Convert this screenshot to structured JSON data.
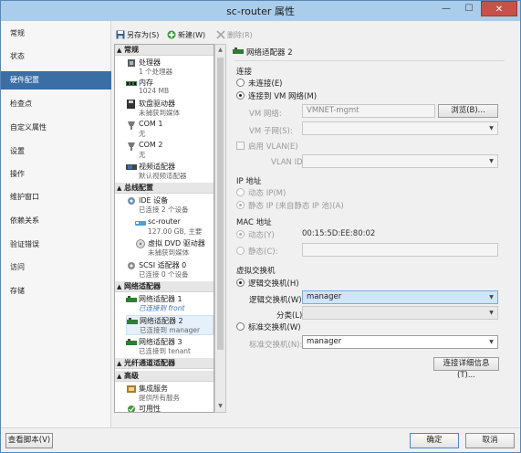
{
  "window": {
    "title": "sc-router 属性",
    "minimize": "—",
    "maximize": "☐",
    "close": "✕"
  },
  "nav": {
    "items": [
      "常规",
      "状态",
      "硬件配置",
      "检查点",
      "自定义属性",
      "设置",
      "操作",
      "维护窗口",
      "依赖关系",
      "验证错误",
      "访问",
      "存储"
    ],
    "active_index": 2
  },
  "toolbar": {
    "save_as": "另存为(S)",
    "new": "新建(W)",
    "delete": "删除(R)"
  },
  "tree": {
    "cat_general": "常规",
    "cpu_label": "处理器",
    "cpu_sub": "1 个处理器",
    "mem_label": "内存",
    "mem_sub": "1024 MB",
    "floppy_label": "软盘驱动器",
    "floppy_sub": "未捕获到媒体",
    "com1_label": "COM 1",
    "com1_sub": "无",
    "com2_label": "COM 2",
    "com2_sub": "无",
    "video_label": "视频适配器",
    "video_sub": "默认视频适配器",
    "cat_bus": "总线配置",
    "ide_label": "IDE 设备",
    "ide_sub": "已连接 2 个设备",
    "disk_label": "sc-router",
    "disk_sub": "127.00 GB, 主要",
    "dvd_label": "虚拟 DVD 驱动器",
    "dvd_sub": "未捕获到媒体",
    "scsi_label": "SCSI 适配器 0",
    "scsi_sub": "已连接 0 个设备",
    "cat_net": "网络适配器",
    "nic1_label": "网络适配器 1",
    "nic1_sub": "已连接到 front",
    "nic2_label": "网络适配器 2",
    "nic2_sub": "已连接到 manager",
    "nic3_label": "网络适配器 3",
    "nic3_sub": "已连接到 tenant",
    "cat_fc": "光纤通道适配器",
    "cat_adv": "高级",
    "integ_label": "集成服务",
    "integ_sub": "提供所有服务",
    "avail_label": "可用性"
  },
  "panel": {
    "title": "网络适配器 2",
    "conn_section": "连接",
    "not_connected": "未连接(E)",
    "connected_vm": "连接到 VM 网络(M)",
    "vm_network_label": "VM 网络:",
    "vm_network_value": "VMNET-mgmt",
    "browse": "浏览(B)...",
    "vm_subnet_label": "VM 子网(S):",
    "enable_vlan": "启用 VLAN(E)",
    "vlan_id_label": "VLAN ID(L):",
    "ip_section": "IP 地址",
    "dynamic_ip": "动态 IP(M)",
    "static_ip": "静态 IP (来自静态 IP 池)(A)",
    "mac_section": "MAC 地址",
    "dynamic_mac": "动态(Y)",
    "mac_value": "00:15:5D:EE:80:02",
    "static_mac": "静态(C):",
    "vswitch_section": "虚拟交换机",
    "logical_switch": "逻辑交换机(H)",
    "logical_switch_label": "逻辑交换机(W):",
    "logical_switch_value": "manager",
    "class_label": "分类(L):",
    "standard_switch": "标准交换机(W)",
    "standard_switch_label": "标准交换机(N):",
    "standard_switch_value": "manager",
    "details": "连接详细信息(T)..."
  },
  "bottom": {
    "view_script": "查看脚本(V)",
    "ok": "确定",
    "cancel": "取消"
  }
}
